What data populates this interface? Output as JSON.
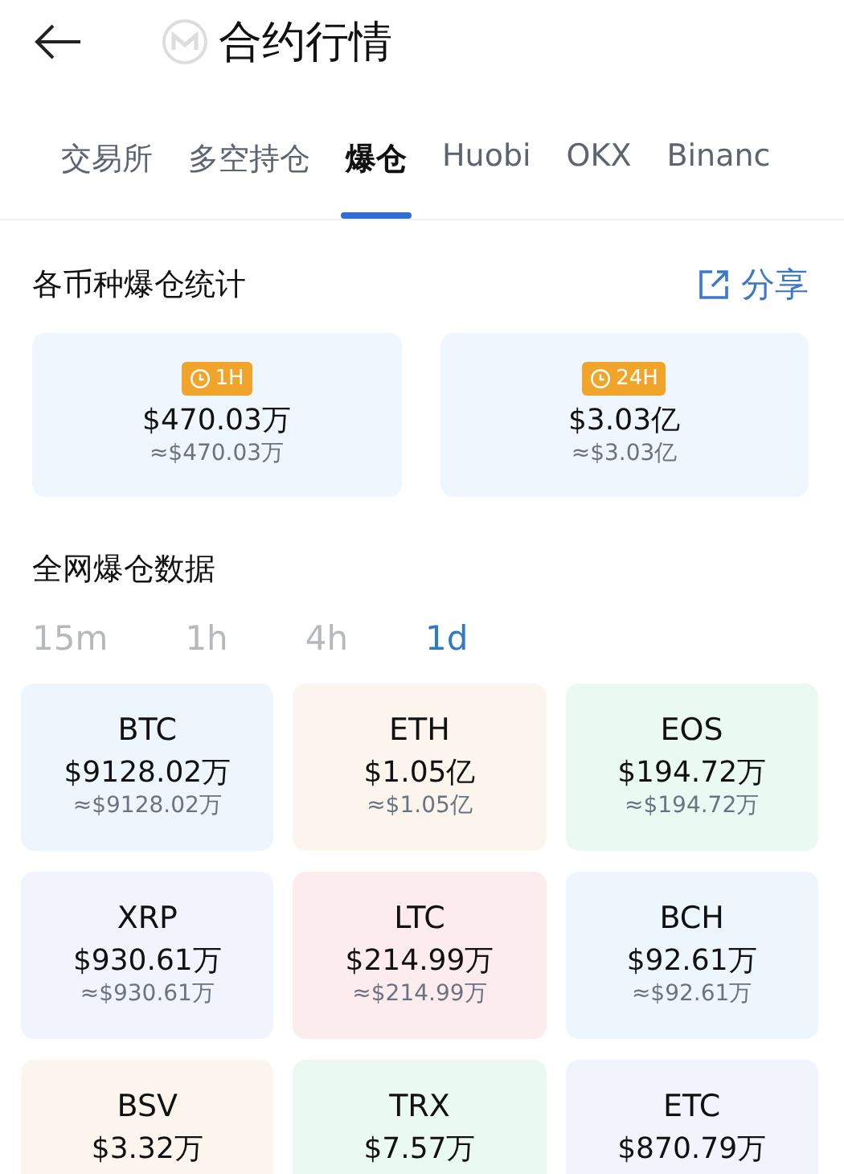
{
  "header": {
    "title": "合约行情"
  },
  "tabs": [
    {
      "label": "交易所",
      "selected": false
    },
    {
      "label": "多空持仓",
      "selected": false
    },
    {
      "label": "爆仓",
      "selected": true
    },
    {
      "label": "Huobi",
      "selected": false
    },
    {
      "label": "OKX",
      "selected": false
    },
    {
      "label": "Binanc",
      "selected": false
    }
  ],
  "summary": {
    "title": "各币种爆仓统计",
    "share": "分享",
    "cards": [
      {
        "period": "1H",
        "value": "$470.03万",
        "approx": "≈$470.03万"
      },
      {
        "period": "24H",
        "value": "$3.03亿",
        "approx": "≈$3.03亿"
      }
    ]
  },
  "network": {
    "title": "全网爆仓数据",
    "intervals": [
      {
        "label": "15m",
        "selected": false
      },
      {
        "label": "1h",
        "selected": false
      },
      {
        "label": "4h",
        "selected": false
      },
      {
        "label": "1d",
        "selected": true
      }
    ],
    "coins": [
      {
        "symbol": "BTC",
        "value": "$9128.02万",
        "approx": "≈$9128.02万",
        "color": "#eef6fd"
      },
      {
        "symbol": "ETH",
        "value": "$1.05亿",
        "approx": "≈$1.05亿",
        "color": "#fbf5ee"
      },
      {
        "symbol": "EOS",
        "value": "$194.72万",
        "approx": "≈$194.72万",
        "color": "#eafaf3"
      },
      {
        "symbol": "XRP",
        "value": "$930.61万",
        "approx": "≈$930.61万",
        "color": "#f1f3fd"
      },
      {
        "symbol": "LTC",
        "value": "$214.99万",
        "approx": "≈$214.99万",
        "color": "#fdeced"
      },
      {
        "symbol": "BCH",
        "value": "$92.61万",
        "approx": "≈$92.61万",
        "color": "#eef6fd"
      },
      {
        "symbol": "BSV",
        "value": "$3.32万",
        "color": "#fbf5ee"
      },
      {
        "symbol": "TRX",
        "value": "$7.57万",
        "color": "#eafaf3"
      },
      {
        "symbol": "ETC",
        "value": "$870.79万",
        "color": "#f1f3fd"
      }
    ]
  }
}
